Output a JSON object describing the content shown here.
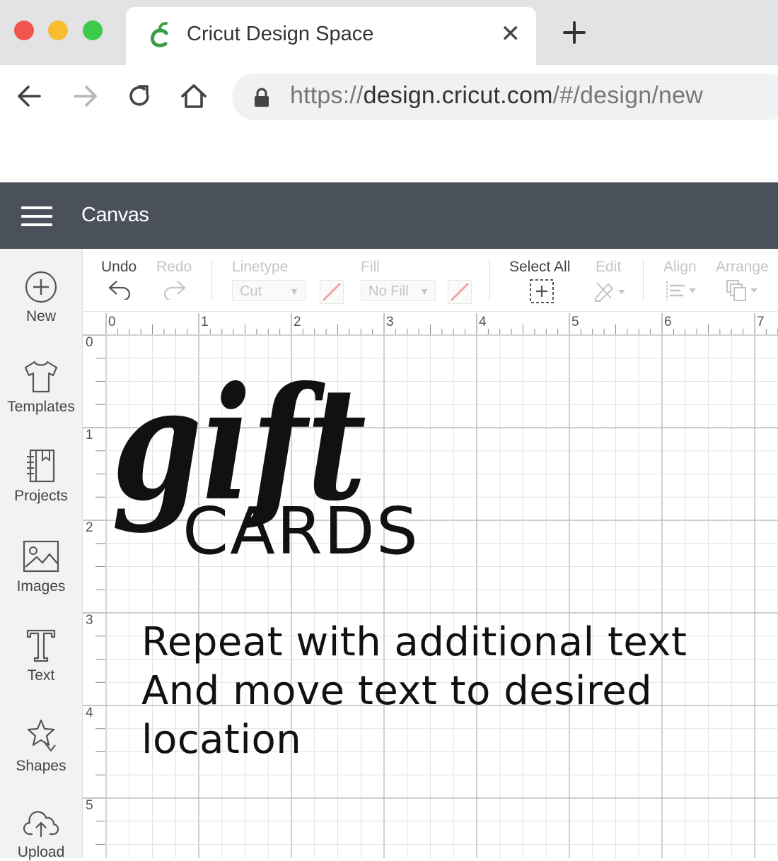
{
  "browser": {
    "tab_title": "Cricut Design Space",
    "tab_close": "✕",
    "url_scheme": "https://",
    "url_host": "design.cricut.com",
    "url_path": "/#/design/new",
    "accent": "#3a9b45"
  },
  "app": {
    "title": "Canvas"
  },
  "sidebar": {
    "items": [
      {
        "label": "New",
        "icon": "plus-circle-icon"
      },
      {
        "label": "Templates",
        "icon": "tshirt-icon"
      },
      {
        "label": "Projects",
        "icon": "notebook-icon"
      },
      {
        "label": "Images",
        "icon": "image-icon"
      },
      {
        "label": "Text",
        "icon": "text-t-icon"
      },
      {
        "label": "Shapes",
        "icon": "shapes-icon"
      },
      {
        "label": "Upload",
        "icon": "cloud-upload-icon"
      }
    ]
  },
  "toolbar": {
    "undo": "Undo",
    "redo": "Redo",
    "linetype_label": "Linetype",
    "linetype_value": "Cut",
    "fill_label": "Fill",
    "fill_value": "No Fill",
    "select_all": "Select All",
    "edit": "Edit",
    "align": "Align",
    "arrange": "Arrange"
  },
  "rulers": {
    "horizontal": [
      "0",
      "1",
      "2",
      "3",
      "4",
      "5",
      "6",
      "7"
    ],
    "vertical": [
      "0",
      "1",
      "2",
      "3",
      "4",
      "5"
    ]
  },
  "canvas": {
    "design_script_word": "gift",
    "design_caps_word": "CARDS",
    "instruction_lines": [
      "Repeat with additional text",
      "And move text to desired",
      "location"
    ]
  }
}
